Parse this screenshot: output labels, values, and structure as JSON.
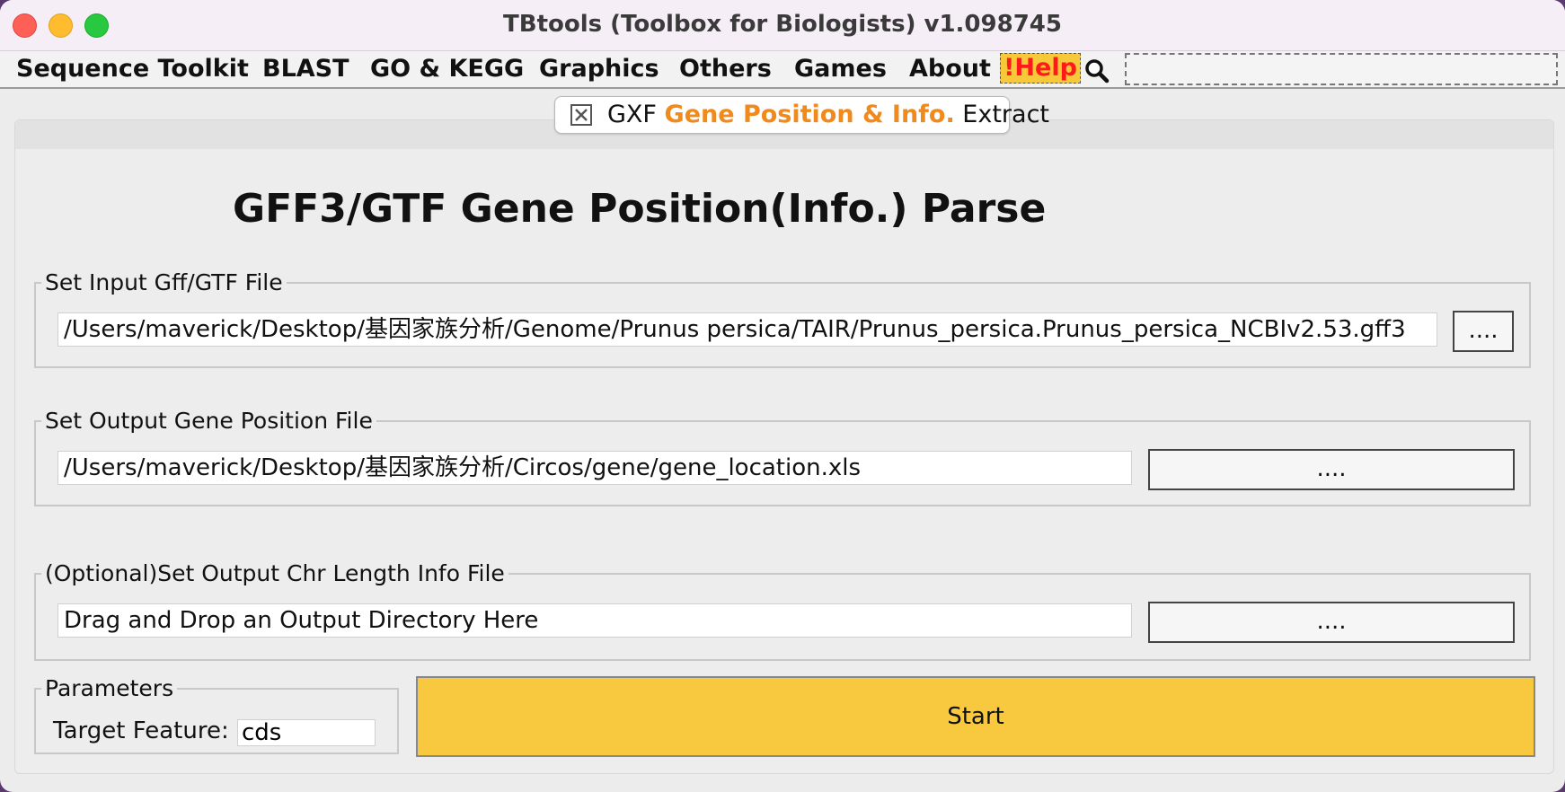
{
  "window": {
    "title": "TBtools (Toolbox for Biologists) v1.098745"
  },
  "menubar": {
    "items": [
      "Sequence Toolkit",
      "BLAST",
      "GO & KEGG",
      "Graphics",
      "Others",
      "Games",
      "About"
    ],
    "help_label": "!Help",
    "search_icon": "magnifier-icon",
    "search_value": ""
  },
  "tab": {
    "close_icon": "close-box-icon",
    "label_prefix": "GXF ",
    "label_highlight": "Gene Position & Info.",
    "label_suffix": " Extract",
    "highlight_color": "#f08a1c"
  },
  "main": {
    "heading": "GFF3/GTF Gene Position(Info.) Parse",
    "input_group": {
      "legend": "Set Input Gff/GTF File",
      "value": "/Users/maverick/Desktop/基因家族分析/Genome/Prunus persica/TAIR/Prunus_persica.Prunus_persica_NCBIv2.53.gff3",
      "browse_label": "...."
    },
    "output_group": {
      "legend": "Set Output Gene Position File",
      "value": "/Users/maverick/Desktop/基因家族分析/Circos/gene/gene_location.xls",
      "browse_label": "...."
    },
    "chr_group": {
      "legend": "(Optional)Set Output Chr Length Info File",
      "value": "Drag and Drop an Output Directory Here",
      "browse_label": "...."
    },
    "parameters": {
      "legend": "Parameters",
      "target_feature_label": "Target Feature:",
      "target_feature_value": "cds"
    },
    "start_label": "Start",
    "start_color": "#f8c83f"
  }
}
